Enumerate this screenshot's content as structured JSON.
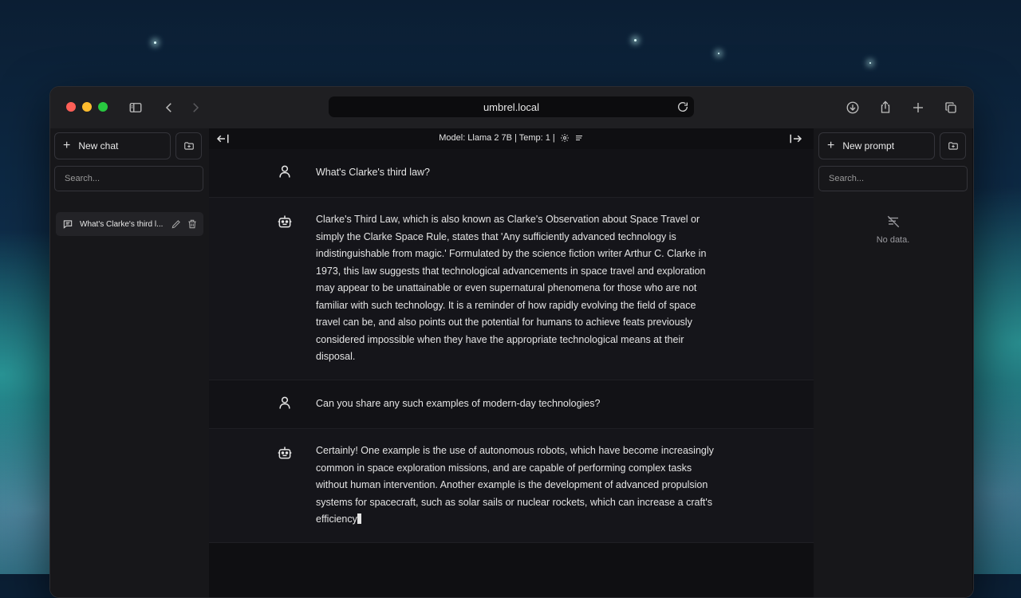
{
  "browser": {
    "url": "umbrel.local",
    "traffic_colors": [
      "#ff5f57",
      "#febc2e",
      "#28c840"
    ]
  },
  "left_sidebar": {
    "new_chat_label": "New chat",
    "search_placeholder": "Search...",
    "conversations": [
      {
        "title": "What's Clarke's third l..."
      }
    ]
  },
  "right_sidebar": {
    "new_prompt_label": "New prompt",
    "search_placeholder": "Search...",
    "empty_text": "No data."
  },
  "topbar": {
    "model_info": "Model: Llama 2 7B | Temp: 1 |"
  },
  "messages": [
    {
      "role": "user",
      "text": "What's Clarke's third law?"
    },
    {
      "role": "assistant",
      "text": "Clarke's Third Law, which is also known as Clarke's Observation about Space Travel or simply the Clarke Space Rule, states that 'Any sufficiently advanced technology is indistinguishable from magic.' Formulated by the science fiction writer Arthur C. Clarke in 1973, this law suggests that technological advancements in space travel and exploration may appear to be unattainable or even supernatural phenomena for those who are not familiar with such technology. It is a reminder of how rapidly evolving the field of space travel can be, and also points out the potential for humans to achieve feats previously considered impossible when they have the appropriate technological means at their disposal."
    },
    {
      "role": "user",
      "text": "Can you share any such examples of modern-day technologies?"
    },
    {
      "role": "assistant",
      "text": "Certainly! One example is the use of autonomous robots, which have become increasingly common in space exploration missions, and are capable of performing complex tasks without human intervention. Another example is the development of advanced propulsion systems for spacecraft, such as solar sails or nuclear rockets, which can increase a craft's efficiency"
    }
  ]
}
